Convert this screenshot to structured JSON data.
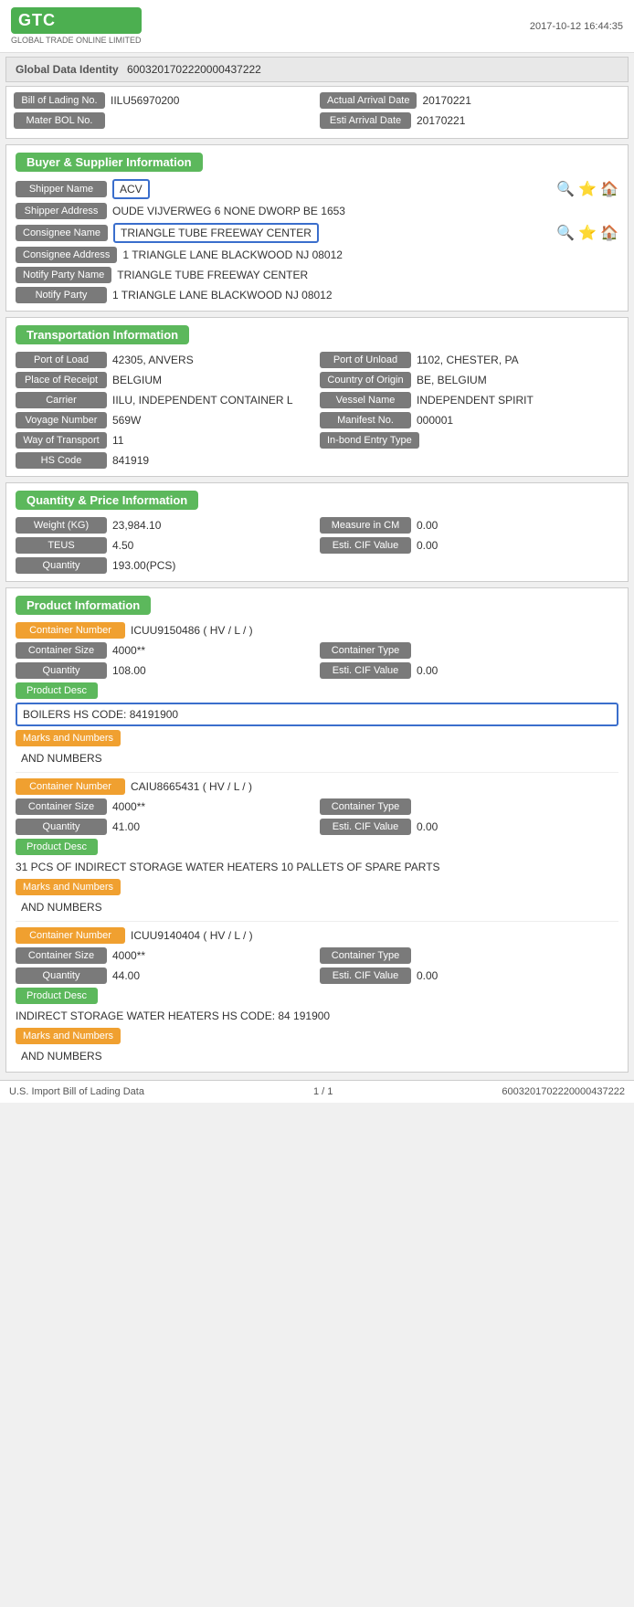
{
  "header": {
    "logo_text": "GTC",
    "logo_sub": "GLOBAL TRADE ONLINE LIMITED",
    "timestamp": "2017-10-12 16:44:35"
  },
  "global_data": {
    "label": "Global Data Identity",
    "value": "60032017022200004​37222"
  },
  "bol_row": {
    "bol_label": "Bill of Lading No.",
    "bol_value": "IILU56970200",
    "arr_label": "Actual Arrival Date",
    "arr_value": "20170221"
  },
  "mater_row": {
    "mater_label": "Mater BOL No.",
    "mater_value": "",
    "esti_label": "Esti Arrival Date",
    "esti_value": "20170221"
  },
  "buyer_supplier": {
    "section_title": "Buyer & Supplier Information",
    "shipper_name_label": "Shipper Name",
    "shipper_name_value": "ACV",
    "shipper_address_label": "Shipper Address",
    "shipper_address_value": "OUDE VIJVERWEG 6 NONE DWORP BE 1653",
    "consignee_name_label": "Consignee Name",
    "consignee_name_value": "TRIANGLE TUBE FREEWAY CENTER",
    "consignee_address_label": "Consignee Address",
    "consignee_address_value": "1 TRIANGLE LANE BLACKWOOD NJ 08012",
    "notify_party_name_label": "Notify Party Name",
    "notify_party_name_value": "TRIANGLE TUBE FREEWAY CENTER",
    "notify_party_label": "Notify Party",
    "notify_party_value": "1 TRIANGLE LANE BLACKWOOD NJ 08012"
  },
  "transport": {
    "section_title": "Transportation Information",
    "port_load_label": "Port of Load",
    "port_load_value": "42305, ANVERS",
    "port_unload_label": "Port of Unload",
    "port_unload_value": "1102, CHESTER, PA",
    "place_receipt_label": "Place of Receipt",
    "place_receipt_value": "BELGIUM",
    "country_origin_label": "Country of Origin",
    "country_origin_value": "BE, BELGIUM",
    "carrier_label": "Carrier",
    "carrier_value": "IILU, INDEPENDENT CONTAINER L",
    "vessel_label": "Vessel Name",
    "vessel_value": "INDEPENDENT SPIRIT",
    "voyage_label": "Voyage Number",
    "voyage_value": "569W",
    "manifest_label": "Manifest No.",
    "manifest_value": "000001",
    "way_transport_label": "Way of Transport",
    "way_transport_value": "11",
    "inbond_label": "In-bond Entry Type",
    "inbond_value": "",
    "hs_code_label": "HS Code",
    "hs_code_value": "841919"
  },
  "quantity_price": {
    "section_title": "Quantity & Price Information",
    "weight_label": "Weight (KG)",
    "weight_value": "23,984.10",
    "measure_label": "Measure in CM",
    "measure_value": "0.00",
    "teus_label": "TEUS",
    "teus_value": "4.50",
    "esti_cif_label": "Esti. CIF Value",
    "esti_cif_value": "0.00",
    "quantity_label": "Quantity",
    "quantity_value": "193.00(PCS)"
  },
  "product_info": {
    "section_title": "Product Information",
    "containers": [
      {
        "container_number_label": "Container Number",
        "container_number_value": "ICUU9150486 ( HV / L / )",
        "container_size_label": "Container Size",
        "container_size_value": "4000**",
        "container_type_label": "Container Type",
        "container_type_value": "",
        "quantity_label": "Quantity",
        "quantity_value": "108.00",
        "esti_cif_label": "Esti. CIF Value",
        "esti_cif_value": "0.00",
        "product_desc_label": "Product Desc",
        "product_desc_value": "BOILERS HS CODE: 84191900",
        "product_desc_outlined": true,
        "marks_label": "Marks and Numbers",
        "marks_value": "AND NUMBERS"
      },
      {
        "container_number_label": "Container Number",
        "container_number_value": "CAIU8665431 ( HV / L / )",
        "container_size_label": "Container Size",
        "container_size_value": "4000**",
        "container_type_label": "Container Type",
        "container_type_value": "",
        "quantity_label": "Quantity",
        "quantity_value": "41.00",
        "esti_cif_label": "Esti. CIF Value",
        "esti_cif_value": "0.00",
        "product_desc_label": "Product Desc",
        "product_desc_value": "31 PCS OF INDIRECT STORAGE WATER HEATERS 10 PALLETS OF SPARE PARTS",
        "product_desc_outlined": false,
        "marks_label": "Marks and Numbers",
        "marks_value": "AND NUMBERS"
      },
      {
        "container_number_label": "Container Number",
        "container_number_value": "ICUU9140404 ( HV / L / )",
        "container_size_label": "Container Size",
        "container_size_value": "4000**",
        "container_type_label": "Container Type",
        "container_type_value": "",
        "quantity_label": "Quantity",
        "quantity_value": "44.00",
        "esti_cif_label": "Esti. CIF Value",
        "esti_cif_value": "0.00",
        "product_desc_label": "Product Desc",
        "product_desc_value": "INDIRECT STORAGE WATER HEATERS HS CODE: 84 191900",
        "product_desc_outlined": false,
        "marks_label": "Marks and Numbers",
        "marks_value": "AND NUMBERS"
      }
    ]
  },
  "footer": {
    "left": "U.S. Import Bill of Lading Data",
    "center": "1 / 1",
    "right": "60032017022200004​37222"
  }
}
